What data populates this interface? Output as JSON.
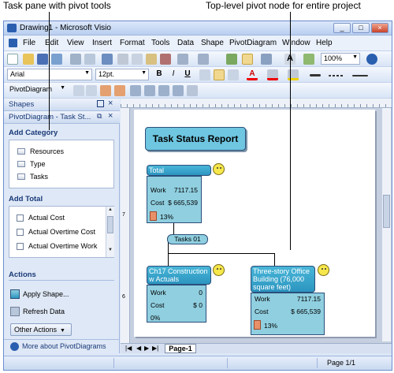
{
  "callouts": {
    "left": "Task pane with pivot tools",
    "right": "Top-level pivot node for entire project"
  },
  "window": {
    "title": "Drawing1 - Microsoft Visio",
    "controls": [
      "_",
      "□",
      "×"
    ]
  },
  "menubar": {
    "items": [
      "File",
      "Edit",
      "View",
      "Insert",
      "Format",
      "Tools",
      "Data",
      "Shape",
      "PivotDiagram",
      "Window",
      "Help"
    ]
  },
  "toolbar": {
    "zoom": "100%",
    "font": "Arial",
    "font_size": "12pt.",
    "bold": "B",
    "italic": "I",
    "underline": "U",
    "pivot_menu": "PivotDiagram",
    "font_color_label": "A"
  },
  "taskpane": {
    "shapes_title": "Shapes",
    "pivot_title": "PivotDiagram - Task St...",
    "add_category_label": "Add Category",
    "categories": [
      "Resources",
      "Type",
      "Tasks"
    ],
    "add_total_label": "Add Total",
    "totals": [
      "Actual Cost",
      "Actual Overtime Cost",
      "Actual Overtime Work"
    ],
    "actions_label": "Actions",
    "apply_shape": "Apply Shape...",
    "refresh_data": "Refresh Data",
    "other_actions": "Other Actions",
    "more_about": "More about PivotDiagrams"
  },
  "diagram": {
    "title": "Task Status Report",
    "total_node": {
      "header": "Total",
      "work_label": "Work",
      "work_value": "7117.15",
      "cost_label": "Cost",
      "cost_value": "$ 665,539",
      "percent": "13%"
    },
    "category_label": "Tasks 01",
    "child1": {
      "header": "Ch17 Construction w Actuals",
      "work_label": "Work",
      "work_value": "0",
      "cost_label": "Cost",
      "cost_value": "$ 0",
      "percent": "0%"
    },
    "child2": {
      "header": "Three-story Office Building (76,000 square feet)",
      "work_label": "Work",
      "work_value": "7117.15",
      "cost_label": "Cost",
      "cost_value": "$ 665,539",
      "percent": "13%"
    }
  },
  "page_tab": "Page-1",
  "status": {
    "page": "Page 1/1"
  },
  "colors": {
    "node_fill": "#8fcfe0",
    "node_header": "#2c95c0",
    "title_fill": "#6ec6e0"
  }
}
